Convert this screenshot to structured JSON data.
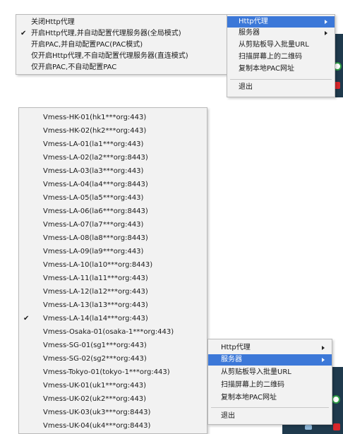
{
  "top_proxy_menu": {
    "items": [
      {
        "label": "关闭Http代理",
        "checked": false
      },
      {
        "label": "开启Http代理,并自动配置代理服务器(全局模式)",
        "checked": true
      },
      {
        "label": "开启PAC,并自动配置PAC(PAC模式)",
        "checked": false
      },
      {
        "label": "仅开启Http代理,不自动配置代理服务器(直连模式)",
        "checked": false
      },
      {
        "label": "仅开启PAC,不自动配置PAC",
        "checked": false
      }
    ],
    "check_glyph": "✔"
  },
  "top_main_menu": {
    "http_proxy": "Http代理",
    "servers": "服务器",
    "import_clipboard": "从剪贴板导入批量URL",
    "scan_qr": "扫描屏幕上的二维码",
    "copy_pac": "复制本地PAC网址",
    "exit": "退出"
  },
  "server_menu": {
    "check_glyph": "✔",
    "items": [
      {
        "label": "Vmess-HK-01(hk1***org:443)",
        "checked": false
      },
      {
        "label": "Vmess-HK-02(hk2***org:443)",
        "checked": false
      },
      {
        "label": "Vmess-LA-01(la1***org:443)",
        "checked": false
      },
      {
        "label": "Vmess-LA-02(la2***org:8443)",
        "checked": false
      },
      {
        "label": "Vmess-LA-03(la3***org:443)",
        "checked": false
      },
      {
        "label": "Vmess-LA-04(la4***org:8443)",
        "checked": false
      },
      {
        "label": "Vmess-LA-05(la5***org:443)",
        "checked": false
      },
      {
        "label": "Vmess-LA-06(la6***org:8443)",
        "checked": false
      },
      {
        "label": "Vmess-LA-07(la7***org:443)",
        "checked": false
      },
      {
        "label": "Vmess-LA-08(la8***org:8443)",
        "checked": false
      },
      {
        "label": "Vmess-LA-09(la9***org:443)",
        "checked": false
      },
      {
        "label": "Vmess-LA-10(la10***org:8443)",
        "checked": false
      },
      {
        "label": "Vmess-LA-11(la11***org:443)",
        "checked": false
      },
      {
        "label": "Vmess-LA-12(la12***org:443)",
        "checked": false
      },
      {
        "label": "Vmess-LA-13(la13***org:443)",
        "checked": false
      },
      {
        "label": "Vmess-LA-14(la14***org:443)",
        "checked": true
      },
      {
        "label": "Vmess-Osaka-01(osaka-1***org:443)",
        "checked": false
      },
      {
        "label": "Vmess-SG-01(sg1***org:443)",
        "checked": false
      },
      {
        "label": "Vmess-SG-02(sg2***org:443)",
        "checked": false
      },
      {
        "label": "Vmess-Tokyo-01(tokyo-1***org:443)",
        "checked": false
      },
      {
        "label": "Vmess-UK-01(uk1***org:443)",
        "checked": false
      },
      {
        "label": "Vmess-UK-02(uk2***org:443)",
        "checked": false
      },
      {
        "label": "Vmess-UK-03(uk3***org:8443)",
        "checked": false
      },
      {
        "label": "Vmess-UK-04(uk4***org:8443)",
        "checked": false
      }
    ]
  },
  "bottom_main_menu": {
    "http_proxy": "Http代理",
    "servers": "服务器",
    "import_clipboard": "从剪贴板导入批量URL",
    "scan_qr": "扫描屏幕上的二维码",
    "copy_pac": "复制本地PAC网址",
    "exit": "退出"
  },
  "colors": {
    "highlight": "#3c78d8",
    "menu_bg": "#f2f2f2",
    "tray_bg": "#1f3a4d"
  }
}
